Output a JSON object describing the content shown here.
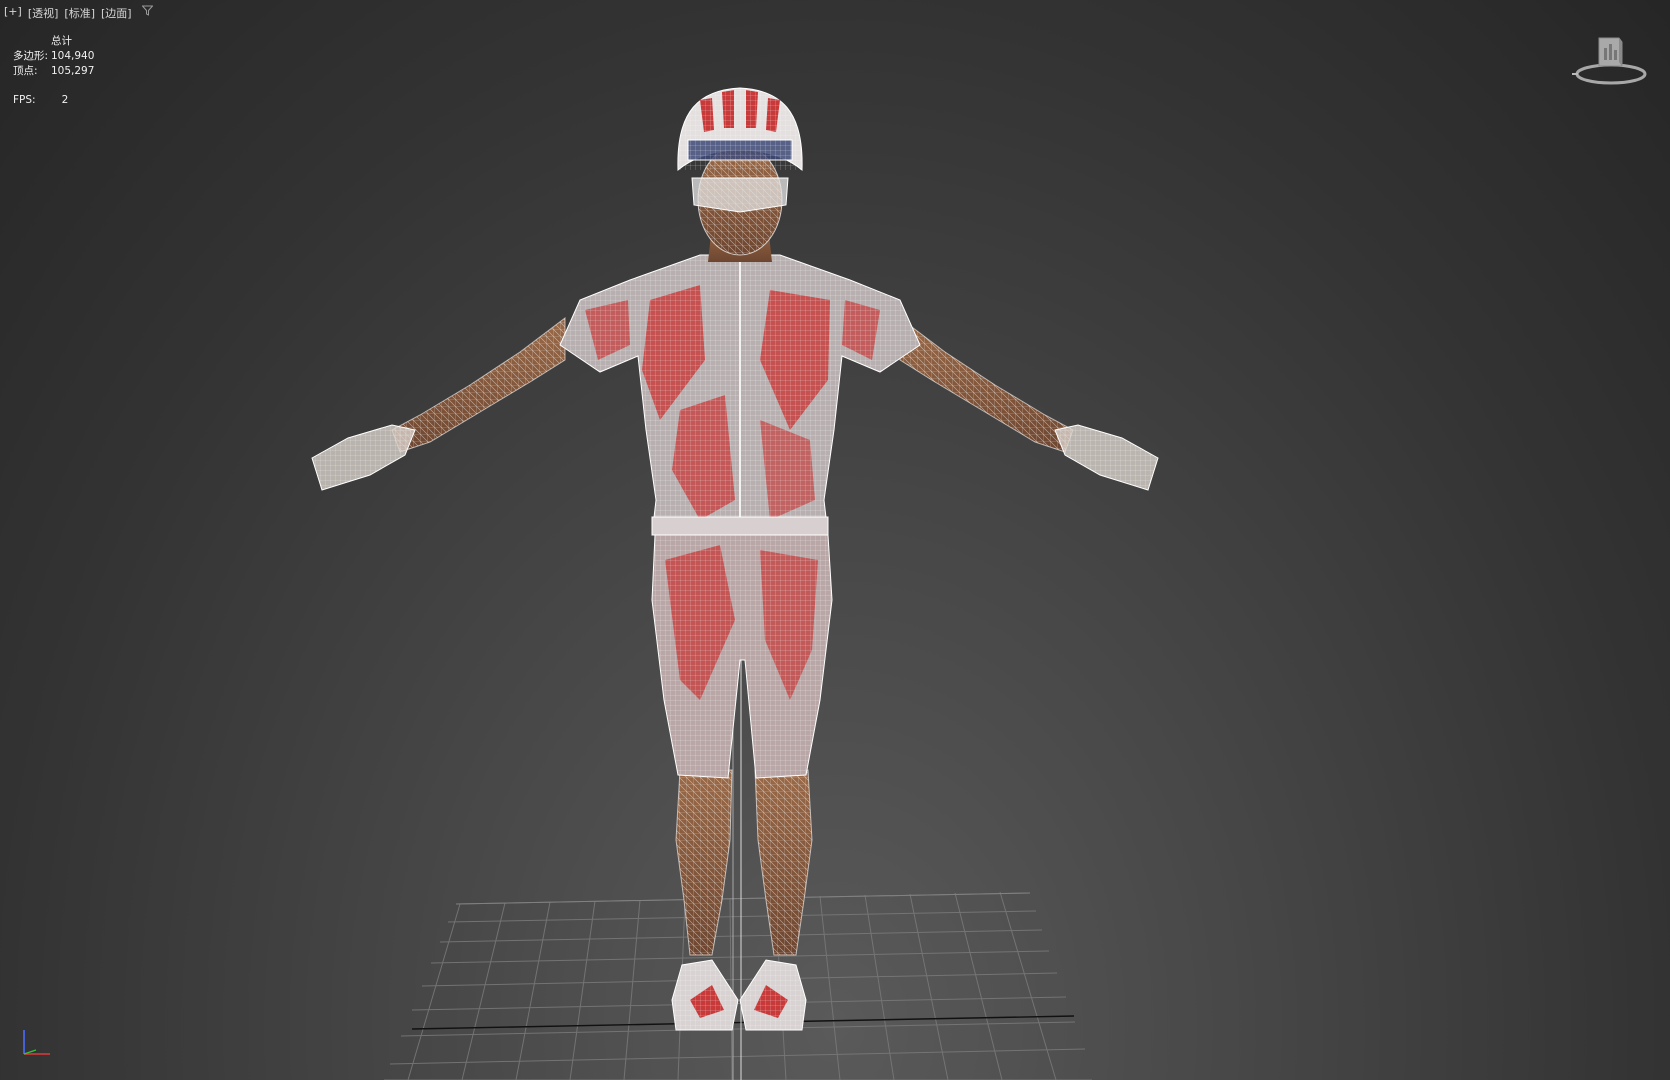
{
  "viewport": {
    "labels": [
      "[+]",
      "[透视]",
      "[标准]",
      "[边面]"
    ],
    "filter_icon": "filter-icon"
  },
  "stats": {
    "header": "总计",
    "polygons_label": "多边形:",
    "polygons_value": "104,940",
    "vertices_label": "顶点:",
    "vertices_value": "105,297",
    "fps_label": "FPS:",
    "fps_value": "2"
  },
  "colors": {
    "background_center": "#5a5a5a",
    "background_edge": "#262626",
    "wireframe": "#ffffff",
    "skin": "#8a5a3c",
    "jersey_red": "#c83a3a",
    "grid": "#7a7a7a"
  },
  "icons": [
    "viewcube-icon",
    "axis-tripod-icon"
  ]
}
